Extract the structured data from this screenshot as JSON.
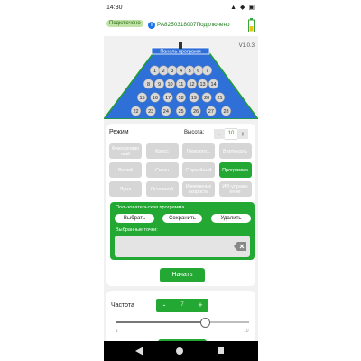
{
  "status_bar": {
    "time": "14:30",
    "icons": "▲ ◆ ▣"
  },
  "header": {
    "status_badge": "Подключено",
    "device_text": "PA8250318007Подключено"
  },
  "version": "V1.0.3",
  "court": {
    "panel_label": "Панель программ",
    "rows": [
      [
        1,
        2,
        3,
        4,
        5,
        6,
        7
      ],
      [
        8,
        9,
        10,
        11,
        12,
        13,
        14
      ],
      [
        15,
        16,
        17,
        18,
        19,
        20,
        21
      ],
      [
        22,
        23,
        24,
        25,
        26,
        27,
        28
      ]
    ]
  },
  "mode": {
    "label": "Режим",
    "height_label": "Высота:",
    "height_value": "10",
    "minus": "-",
    "plus": "+",
    "buttons": [
      {
        "label": "Фиксирован ный"
      },
      {
        "label": "Кросс"
      },
      {
        "label": "Горизонт..."
      },
      {
        "label": "Вертикаль"
      },
      {
        "label": "Волей"
      },
      {
        "label": "Смэш"
      },
      {
        "label": "Случайный"
      },
      {
        "label": "Программа"
      },
      {
        "label": "Луна"
      },
      {
        "label": "Основной"
      },
      {
        "label": "Изменение скорости"
      },
      {
        "label": "ИИ-упражн ение"
      }
    ],
    "active_index": 7
  },
  "program": {
    "title": "Пользовательская программа",
    "select_label": "Выбрать",
    "save_label": "Сохранить",
    "delete_label": "Удалить",
    "points_label": "Выбранные точки:"
  },
  "start_label": "Начать",
  "frequency": {
    "label": "Частота",
    "minus": "-",
    "plus": "+",
    "value": "7",
    "min": "1",
    "max": "10",
    "slider_fraction": 0.67
  },
  "colors": {
    "accent": "#22a833",
    "court_blue": "#2f6fd8",
    "court_border": "#1f9f2f"
  }
}
